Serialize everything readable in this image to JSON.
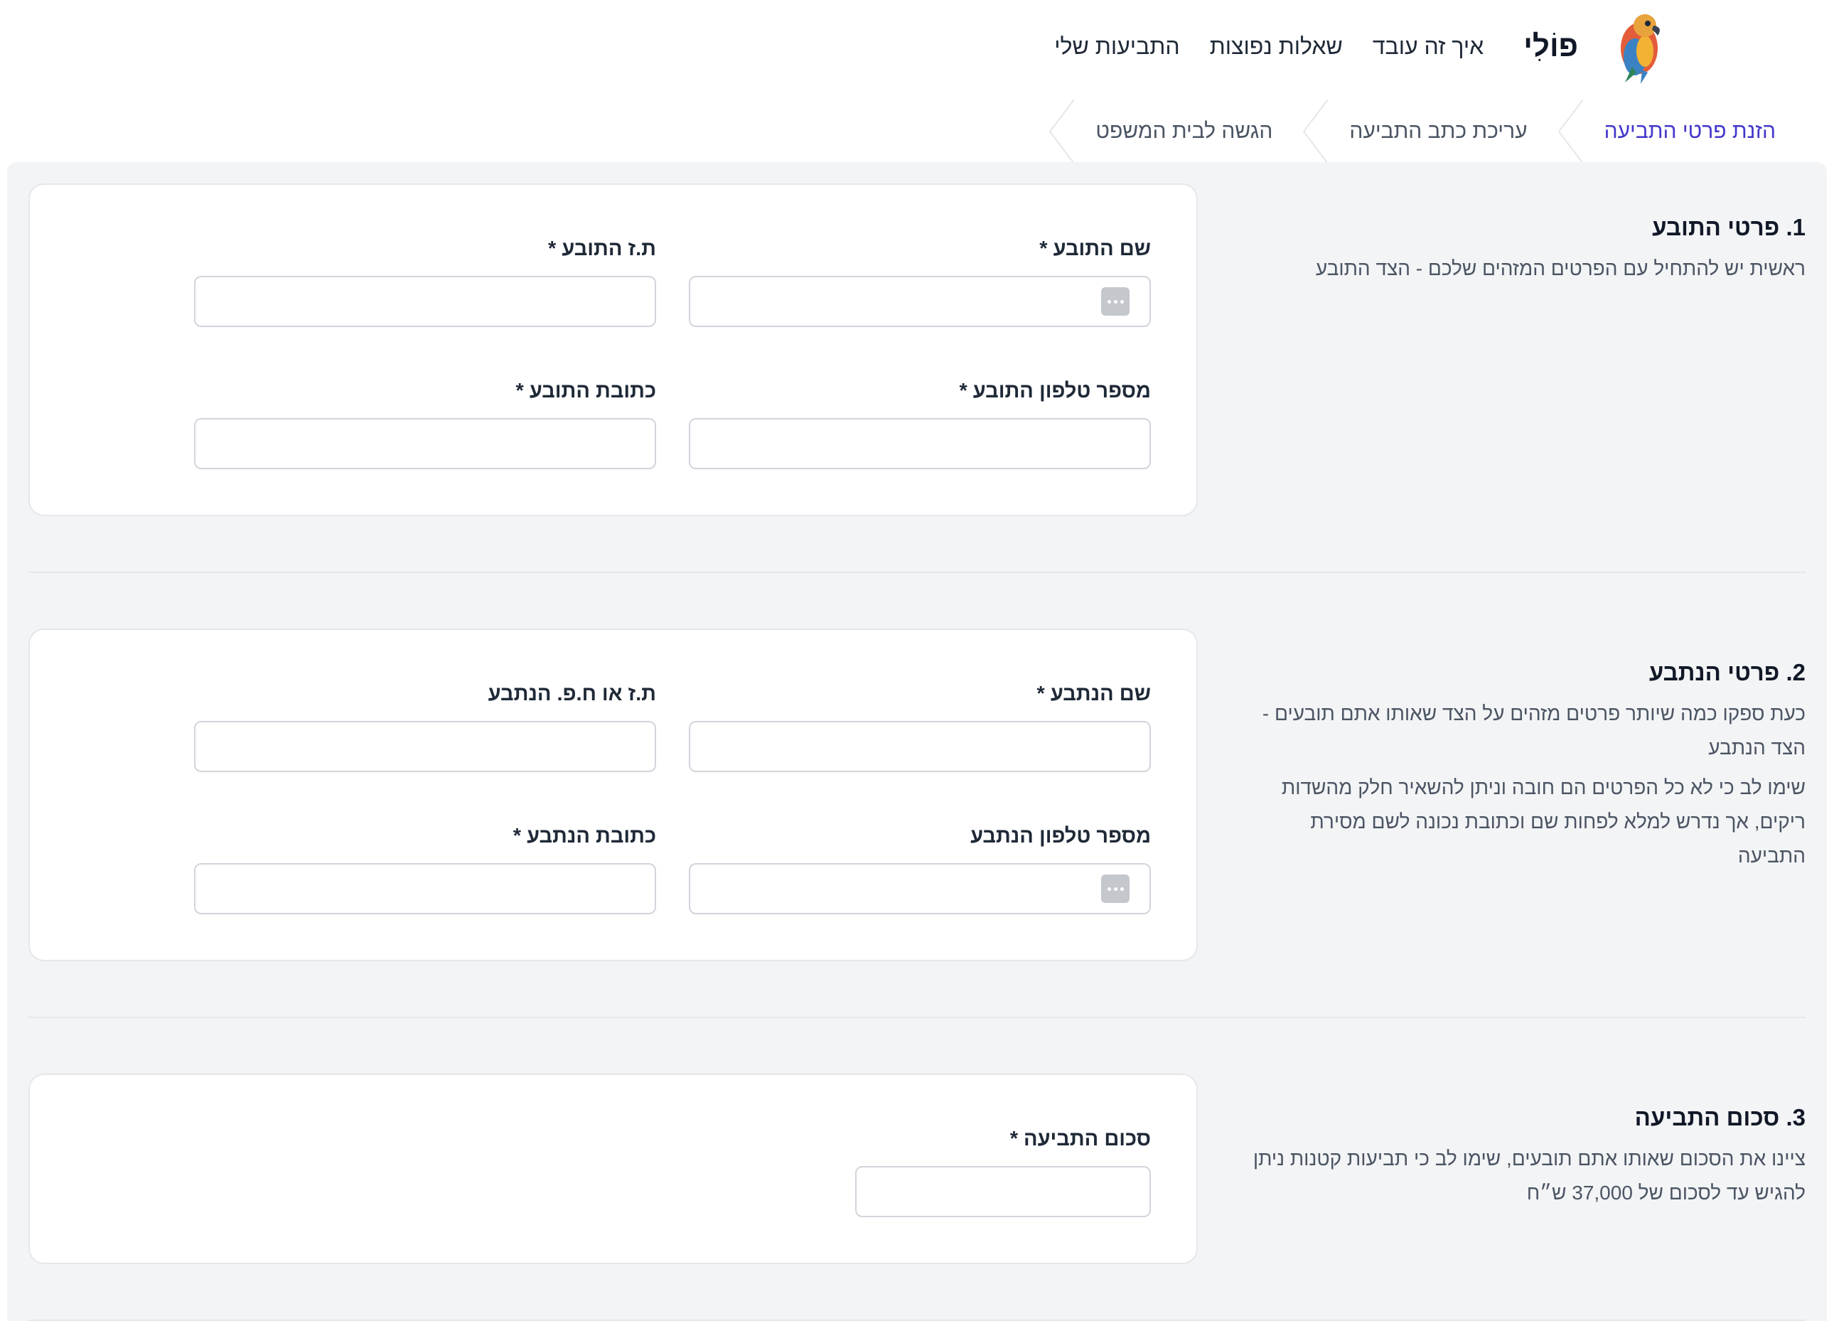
{
  "header": {
    "brand": "פוֹלִי",
    "nav": [
      "איך זה עובד",
      "שאלות נפוצות",
      "התביעות שלי"
    ]
  },
  "steps": [
    {
      "label": "הזנת פרטי התביעה",
      "active": true
    },
    {
      "label": "עריכת כתב התביעה",
      "active": false
    },
    {
      "label": "הגשה לבית המשפט",
      "active": false
    }
  ],
  "sections": [
    {
      "title": "1. פרטי התובע",
      "desc": [
        "ראשית יש להתחיל עם הפרטים המזהים שלכם - הצד התובע"
      ],
      "fields": {
        "name": {
          "label": "שם התובע *",
          "value": ""
        },
        "id": {
          "label": "ת.ז התובע *",
          "value": ""
        },
        "phone": {
          "label": "מספר טלפון התובע *",
          "value": ""
        },
        "address": {
          "label": "כתובת התובע *",
          "value": ""
        }
      }
    },
    {
      "title": "2. פרטי הנתבע",
      "desc": [
        "כעת ספקו כמה שיותר פרטים מזהים על הצד שאותו אתם תובעים - הצד הנתבע",
        "שימו לב כי לא כל הפרטים הם חובה וניתן להשאיר חלק מהשדות ריקים, אך נדרש למלא לפחות שם וכתובת נכונה לשם מסירת התביעה"
      ],
      "fields": {
        "name": {
          "label": "שם הנתבע *",
          "value": ""
        },
        "id": {
          "label": "ת.ז או ח.פ. הנתבע",
          "value": ""
        },
        "phone": {
          "label": "מספר טלפון הנתבע",
          "value": ""
        },
        "address": {
          "label": "כתובת הנתבע *",
          "value": ""
        }
      }
    },
    {
      "title": "3. סכום התביעה",
      "desc": [
        "ציינו את הסכום שאותו אתם תובעים, שימו לב כי תביעות קטנות ניתן להגיש עד לסכום של 37,000 ש״ח"
      ],
      "fields": {
        "amount": {
          "label": "סכום התביעה *",
          "value": ""
        }
      }
    }
  ],
  "icons": {
    "logo": "parrot-logo-icon",
    "field_menu": "more-horizontal-icon",
    "step_separator": "chevron-left-icon"
  },
  "colors": {
    "accent": "#4338ca",
    "panel_bg": "#f3f4f6",
    "card_border": "#e5e7eb"
  }
}
